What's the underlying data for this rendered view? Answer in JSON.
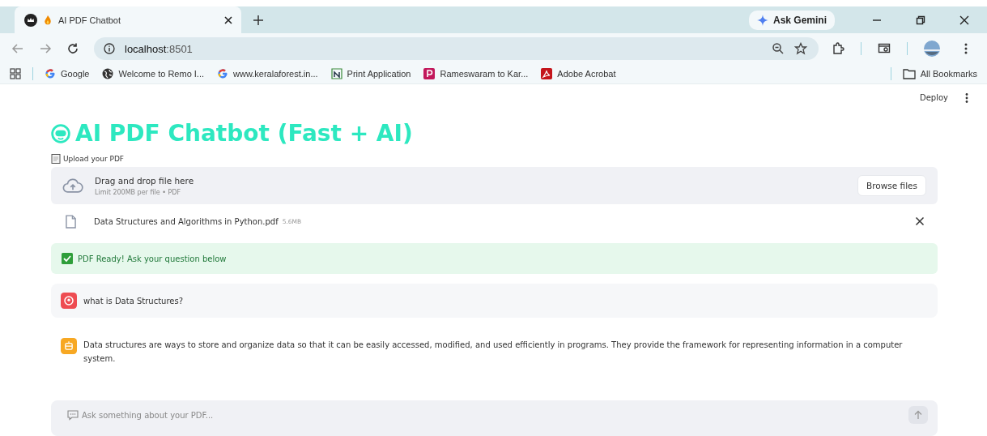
{
  "browser": {
    "tab": {
      "title": "AI PDF Chatbot",
      "selected": true
    },
    "ask_gemini": "Ask Gemini",
    "url_host": "localhost",
    "url_port": ":8501",
    "bookmarks": [
      {
        "kind": "google",
        "label": "Google"
      },
      {
        "kind": "globe",
        "label": "Welcome to Remo I..."
      },
      {
        "kind": "google",
        "label": "www.keralaforest.in..."
      },
      {
        "kind": "notion",
        "label": "Print Application"
      },
      {
        "kind": "p",
        "label": "Rameswaram to Kar..."
      },
      {
        "kind": "acrobat",
        "label": "Adobe Acrobat"
      }
    ],
    "all_bookmarks": "All Bookmarks"
  },
  "app": {
    "deploy": "Deploy",
    "title": "AI PDF Chatbot (Fast + AI)",
    "uploader": {
      "label": "Upload your PDF",
      "drop_text": "Drag and drop file here",
      "limit": "Limit 200MB per file • PDF",
      "browse": "Browse files"
    },
    "file": {
      "name": "Data Structures and Algorithms in Python.pdf",
      "size": "5.6MB"
    },
    "success": "PDF Ready! Ask your question below",
    "messages": [
      {
        "kind": "user",
        "text": "what is Data Structures?"
      },
      {
        "kind": "assistant",
        "text": "Data structures are ways to store and organize data so that it can be easily accessed, modified, and used efficiently in programs. They provide the framework for representing information in a computer system."
      }
    ],
    "chat_input": {
      "placeholder": "Ask something about your PDF..."
    }
  }
}
